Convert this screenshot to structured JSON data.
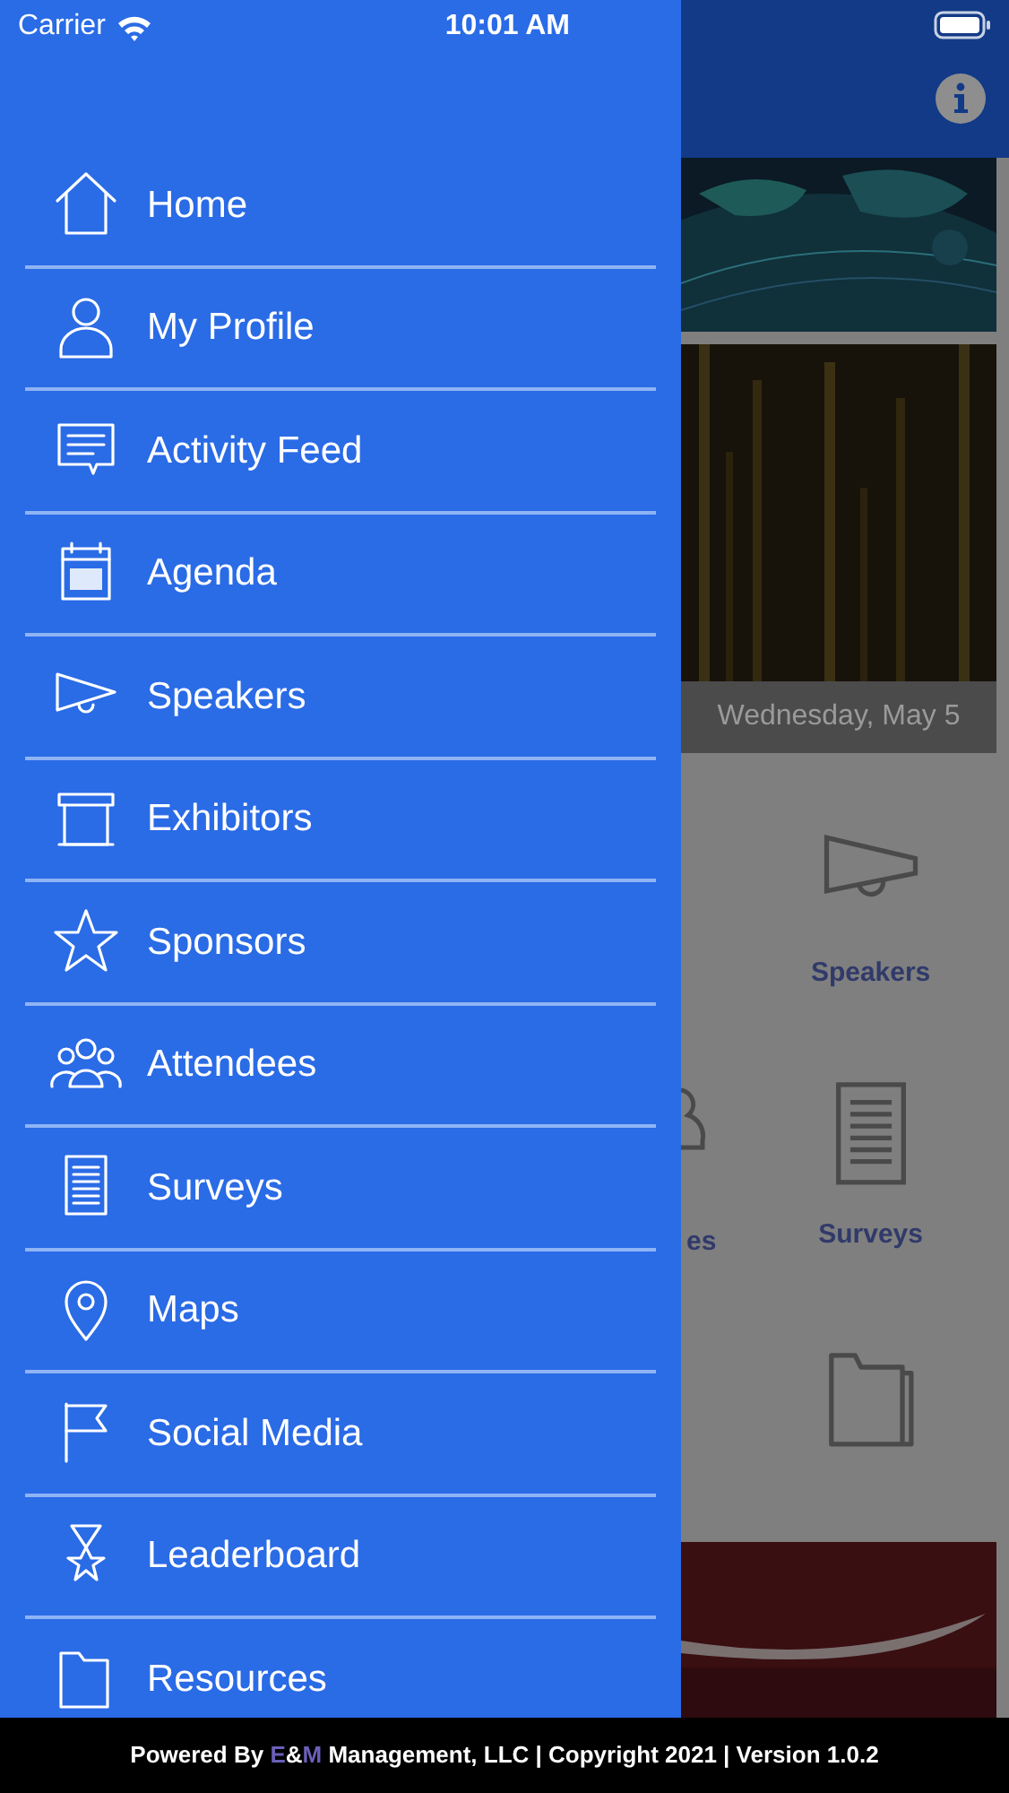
{
  "status_bar": {
    "carrier": "Carrier",
    "time": "10:01 AM"
  },
  "menu": [
    {
      "label": "Home"
    },
    {
      "label": "My Profile"
    },
    {
      "label": "Activity Feed"
    },
    {
      "label": "Agenda"
    },
    {
      "label": "Speakers"
    },
    {
      "label": "Exhibitors"
    },
    {
      "label": "Sponsors"
    },
    {
      "label": "Attendees"
    },
    {
      "label": "Surveys"
    },
    {
      "label": "Maps"
    },
    {
      "label": "Social Media"
    },
    {
      "label": "Leaderboard"
    },
    {
      "label": "Resources"
    }
  ],
  "background_screen": {
    "banner_caption": "Wednesday, May 5",
    "grid": [
      {
        "right_label": "Speakers"
      },
      {
        "left_label": "es",
        "right_label": "Surveys"
      }
    ]
  },
  "footer": [
    {
      "text": "Powered By ",
      "accent": false
    },
    {
      "text": "E",
      "accent": true
    },
    {
      "text": "&",
      "accent": false
    },
    {
      "text": "M",
      "accent": true
    },
    {
      "text": " Management, LLC | Copyright 2021 | Version 1.0.2",
      "accent": false
    }
  ]
}
